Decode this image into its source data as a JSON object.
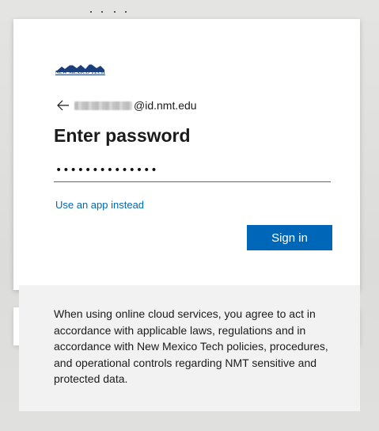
{
  "brand": {
    "logo_text": "NEW MEXICO TECH",
    "logo_color": "#1b3f7a"
  },
  "identity": {
    "back_icon": "arrow-left-icon",
    "email_domain": "@id.nmt.edu"
  },
  "form": {
    "title": "Enter password",
    "password_value": "••••••••••••••",
    "alt_link": "Use an app instead",
    "submit_label": "Sign in"
  },
  "notice": {
    "text": "When using online cloud services, you agree to act in accordance with applicable laws, regulations and in accordance with New Mexico Tech policies, procedures, and operational controls regarding NMT sensitive and protected data."
  },
  "colors": {
    "accent": "#0067b8",
    "notice_bg": "#f2f2f2"
  }
}
